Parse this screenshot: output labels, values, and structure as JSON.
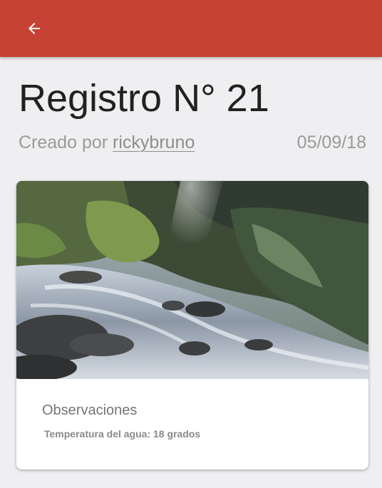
{
  "app_bar": {
    "color": "#c64234",
    "back_icon": "arrow-back-icon"
  },
  "record": {
    "title": "Registro N° 21",
    "created_by_prefix": "Creado por",
    "author": "rickybruno",
    "date": "05/09/18"
  },
  "card": {
    "image": "river-stream-photo",
    "section_title": "Observaciones",
    "text": "Temperatura del agua: 18 grados"
  }
}
